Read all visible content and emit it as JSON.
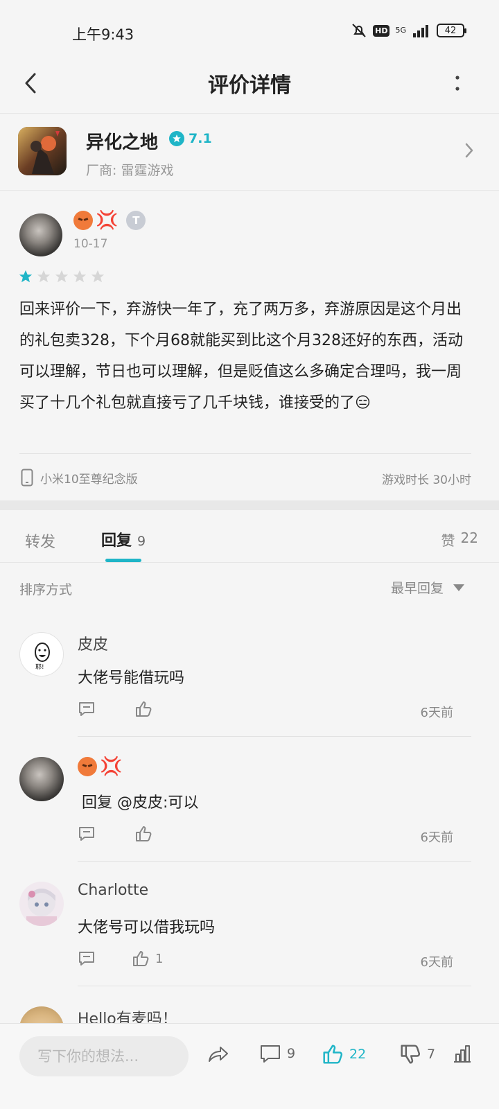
{
  "status_bar": {
    "time": "上午9:43",
    "hd": "HD",
    "network": "5G",
    "battery": "42"
  },
  "nav": {
    "title": "评价详情"
  },
  "game": {
    "name": "异化之地",
    "rating": "7.1",
    "vendor": "厂商: 雷霆游戏"
  },
  "review": {
    "date": "10-17",
    "level_badge": "T",
    "stars": 1,
    "stars_max": 5,
    "text": "回来评价一下，弃游快一年了，充了两万多，弃游原因是这个月出的礼包卖328，下个月68就能买到比这个月328还好的东西，活动可以理解，节日也可以理解，但是贬值这么多确定合理吗，我一周买了十几个礼包就直接亏了几千块钱，谁接受的了😑",
    "device": "小米10至尊纪念版",
    "playtime": "游戏时长 30小时"
  },
  "tabs": {
    "forward": "转发",
    "reply": "回复",
    "reply_count": "9",
    "likes_label": "赞",
    "likes_count": "22"
  },
  "sort": {
    "label": "排序方式",
    "value": "最早回复"
  },
  "comments": [
    {
      "name": "皮皮",
      "text": "大佬号能借玩吗",
      "likes": "",
      "time": "6天前"
    },
    {
      "name": "",
      "text": "回复 @皮皮:可以",
      "likes": "",
      "time": "6天前"
    },
    {
      "name": "Charlotte",
      "text": "大佬号可以借我玩吗",
      "likes": "1",
      "time": "6天前"
    },
    {
      "name": "Hello有麦吗！"
    }
  ],
  "bottom_bar": {
    "placeholder": "写下你的想法...",
    "comment_count": "9",
    "like_count": "22",
    "dislike_count": "7"
  },
  "colors": {
    "accent": "#1fb5c7",
    "text": "#222222",
    "muted": "#888888"
  }
}
